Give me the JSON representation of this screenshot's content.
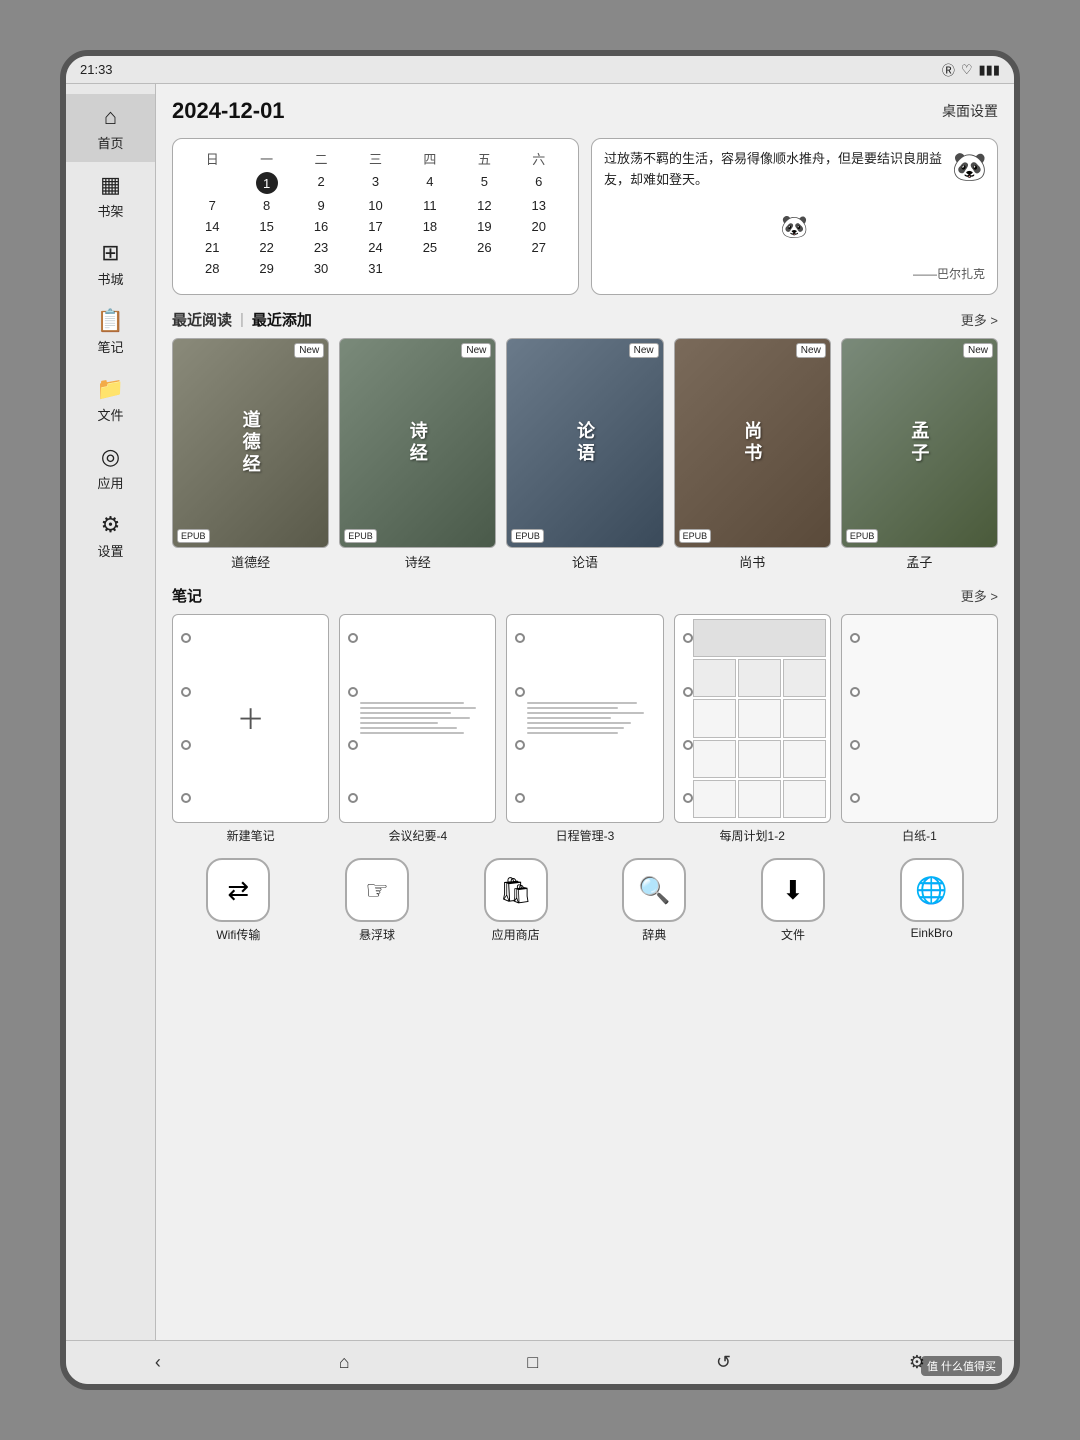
{
  "device": {
    "status_bar": {
      "time": "21:33",
      "icons": [
        "R",
        "♡",
        "▮▮▮"
      ]
    }
  },
  "header": {
    "date": "2024-12-01",
    "settings_label": "桌面设置"
  },
  "calendar": {
    "days_header": [
      "日",
      "一",
      "二",
      "三",
      "四",
      "五",
      "六"
    ],
    "weeks": [
      [
        "",
        "2",
        "3",
        "4",
        "5",
        "6",
        "7"
      ],
      [
        "8",
        "9",
        "10",
        "11",
        "12",
        "13",
        "14"
      ],
      [
        "15",
        "16",
        "17",
        "18",
        "19",
        "20",
        "21"
      ],
      [
        "22",
        "23",
        "24",
        "25",
        "26",
        "27",
        "28"
      ],
      [
        "29",
        "30",
        "31",
        "",
        "",
        "",
        ""
      ]
    ],
    "today": "1"
  },
  "quote": {
    "text": "过放荡不羁的生活，容易得像顺水推舟，但是要结识良朋益友，却难如登天。",
    "author": "——巴尔扎克"
  },
  "recent_section": {
    "tab_recent_read": "最近阅读",
    "tab_recent_add": "最近添加",
    "more_label": "更多 >"
  },
  "books": [
    {
      "title": "道德经",
      "cover_text": "道德经",
      "badge": "New",
      "format": "EPUB",
      "cover_class": "cover-1"
    },
    {
      "title": "诗经",
      "cover_text": "诗经",
      "badge": "New",
      "format": "EPUB",
      "cover_class": "cover-2"
    },
    {
      "title": "论语",
      "cover_text": "论语",
      "badge": "New",
      "format": "EPUB",
      "cover_class": "cover-3"
    },
    {
      "title": "尚书",
      "cover_text": "尚书",
      "badge": "New",
      "format": "EPUB",
      "cover_class": "cover-4"
    },
    {
      "title": "孟子",
      "cover_text": "孟子",
      "badge": "New",
      "format": "EPUB",
      "cover_class": "cover-5"
    }
  ],
  "notes_section": {
    "title": "笔记",
    "more_label": "更多 >"
  },
  "notes": [
    {
      "title": "新建笔记",
      "type": "new"
    },
    {
      "title": "会议纪要-4",
      "type": "lines"
    },
    {
      "title": "日程管理-3",
      "type": "lines2"
    },
    {
      "title": "每周计划1-2",
      "type": "grid"
    },
    {
      "title": "白纸-1",
      "type": "blank"
    }
  ],
  "apps": [
    {
      "label": "Wifi传输",
      "icon": "⇄"
    },
    {
      "label": "悬浮球",
      "icon": "☞"
    },
    {
      "label": "应用商店",
      "icon": "🛍"
    },
    {
      "label": "辞典",
      "icon": "🔍"
    },
    {
      "label": "文件",
      "icon": "⬇"
    },
    {
      "label": "EinkBro",
      "icon": "🌐"
    }
  ],
  "sidebar": {
    "items": [
      {
        "label": "首页",
        "icon": "⌂",
        "active": true
      },
      {
        "label": "书架",
        "icon": "📊"
      },
      {
        "label": "书城",
        "icon": "🏪"
      },
      {
        "label": "笔记",
        "icon": "📋"
      },
      {
        "label": "文件",
        "icon": "📁"
      },
      {
        "label": "应用",
        "icon": "⊙"
      },
      {
        "label": "设置",
        "icon": "⚙"
      }
    ]
  },
  "bottom_nav": {
    "buttons": [
      "‹",
      "⌂",
      "□",
      "↺",
      "⚙"
    ]
  },
  "watermark": "值 什么值得买"
}
